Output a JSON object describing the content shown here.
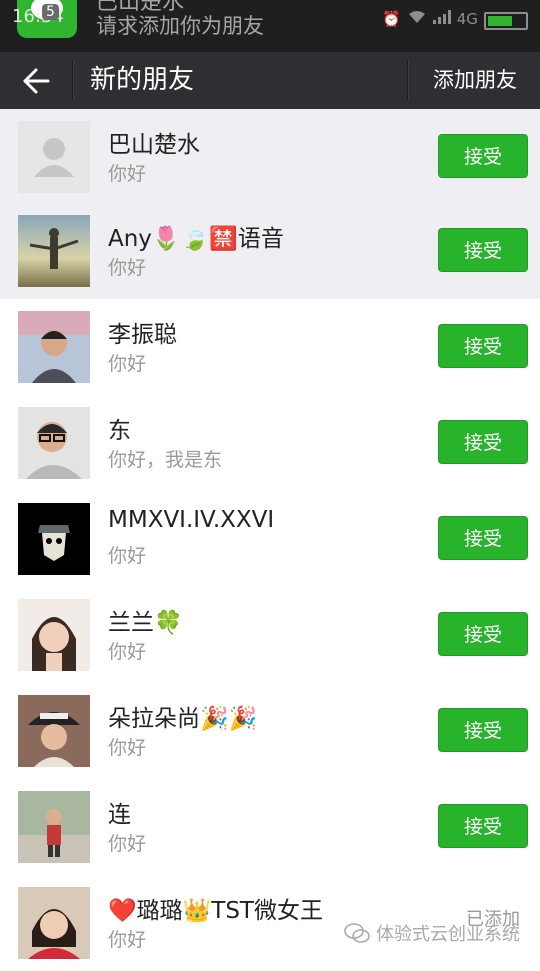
{
  "status_bar": {
    "time": "16:34",
    "badge": "5",
    "notification_title": "巴山楚水",
    "notification_text": "请求添加你为朋友",
    "network": "4G"
  },
  "title_bar": {
    "title": "新的朋友",
    "action_label": "添加朋友"
  },
  "requests": [
    {
      "name": "巴山楚水",
      "message": "你好",
      "action": "接受",
      "status": "pending",
      "shaded": true,
      "avatar": "default-avatar"
    },
    {
      "name": "Any🌷🍃🈲语音",
      "message": "你好",
      "action": "接受",
      "status": "pending",
      "shaded": true,
      "avatar": "photo-landscape"
    },
    {
      "name": "李振聪",
      "message": "你好",
      "action": "接受",
      "status": "pending",
      "shaded": false,
      "avatar": "photo-person"
    },
    {
      "name": "东",
      "message": "你好，我是东",
      "action": "接受",
      "status": "pending",
      "shaded": false,
      "avatar": "photo-person-glasses"
    },
    {
      "name": "MMXVI.IV.XXVI",
      "message": "你好",
      "action": "接受",
      "status": "pending",
      "shaded": false,
      "avatar": "photo-dark-mask"
    },
    {
      "name": "兰兰🍀",
      "message": "你好",
      "action": "接受",
      "status": "pending",
      "shaded": false,
      "avatar": "photo-woman"
    },
    {
      "name": "朵拉朵尚🎉🎉",
      "message": "你好",
      "action": "接受",
      "status": "pending",
      "shaded": false,
      "avatar": "photo-woman-hat"
    },
    {
      "name": "连",
      "message": "你好",
      "action": "接受",
      "status": "pending",
      "shaded": false,
      "avatar": "photo-child"
    },
    {
      "name": "❤️璐璐👑TST微女王",
      "message": "你好",
      "action": "已添加",
      "status": "added",
      "shaded": false,
      "avatar": "photo-woman-red"
    }
  ],
  "watermark": "体验式云创业系统",
  "colors": {
    "accent": "#27b32b",
    "title_bar": "#2e2e33",
    "status_bar": "#1f1f1f",
    "shaded_row": "#eeeef3"
  }
}
